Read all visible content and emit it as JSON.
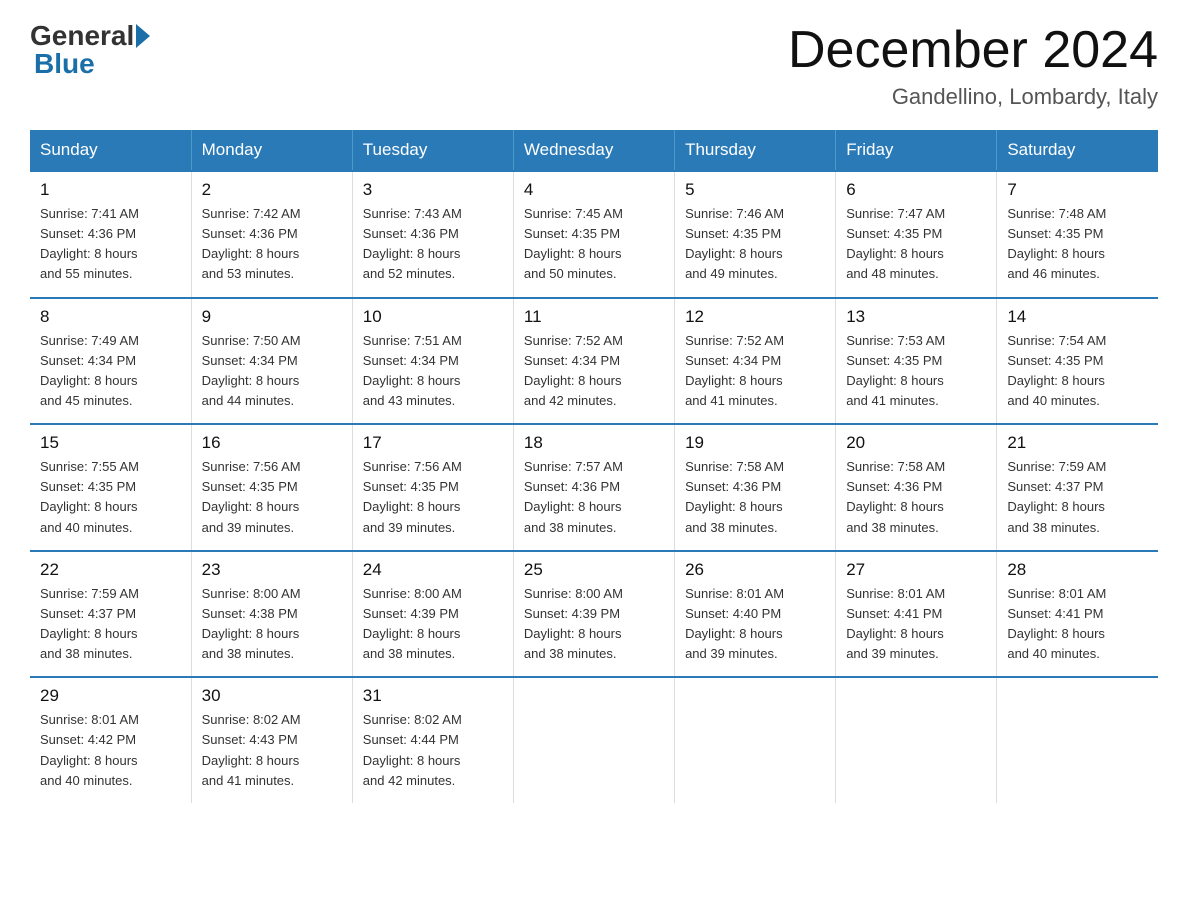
{
  "logo": {
    "general": "General",
    "blue": "Blue"
  },
  "title": "December 2024",
  "location": "Gandellino, Lombardy, Italy",
  "days_header": [
    "Sunday",
    "Monday",
    "Tuesday",
    "Wednesday",
    "Thursday",
    "Friday",
    "Saturday"
  ],
  "weeks": [
    [
      {
        "num": "1",
        "info": "Sunrise: 7:41 AM\nSunset: 4:36 PM\nDaylight: 8 hours\nand 55 minutes."
      },
      {
        "num": "2",
        "info": "Sunrise: 7:42 AM\nSunset: 4:36 PM\nDaylight: 8 hours\nand 53 minutes."
      },
      {
        "num": "3",
        "info": "Sunrise: 7:43 AM\nSunset: 4:36 PM\nDaylight: 8 hours\nand 52 minutes."
      },
      {
        "num": "4",
        "info": "Sunrise: 7:45 AM\nSunset: 4:35 PM\nDaylight: 8 hours\nand 50 minutes."
      },
      {
        "num": "5",
        "info": "Sunrise: 7:46 AM\nSunset: 4:35 PM\nDaylight: 8 hours\nand 49 minutes."
      },
      {
        "num": "6",
        "info": "Sunrise: 7:47 AM\nSunset: 4:35 PM\nDaylight: 8 hours\nand 48 minutes."
      },
      {
        "num": "7",
        "info": "Sunrise: 7:48 AM\nSunset: 4:35 PM\nDaylight: 8 hours\nand 46 minutes."
      }
    ],
    [
      {
        "num": "8",
        "info": "Sunrise: 7:49 AM\nSunset: 4:34 PM\nDaylight: 8 hours\nand 45 minutes."
      },
      {
        "num": "9",
        "info": "Sunrise: 7:50 AM\nSunset: 4:34 PM\nDaylight: 8 hours\nand 44 minutes."
      },
      {
        "num": "10",
        "info": "Sunrise: 7:51 AM\nSunset: 4:34 PM\nDaylight: 8 hours\nand 43 minutes."
      },
      {
        "num": "11",
        "info": "Sunrise: 7:52 AM\nSunset: 4:34 PM\nDaylight: 8 hours\nand 42 minutes."
      },
      {
        "num": "12",
        "info": "Sunrise: 7:52 AM\nSunset: 4:34 PM\nDaylight: 8 hours\nand 41 minutes."
      },
      {
        "num": "13",
        "info": "Sunrise: 7:53 AM\nSunset: 4:35 PM\nDaylight: 8 hours\nand 41 minutes."
      },
      {
        "num": "14",
        "info": "Sunrise: 7:54 AM\nSunset: 4:35 PM\nDaylight: 8 hours\nand 40 minutes."
      }
    ],
    [
      {
        "num": "15",
        "info": "Sunrise: 7:55 AM\nSunset: 4:35 PM\nDaylight: 8 hours\nand 40 minutes."
      },
      {
        "num": "16",
        "info": "Sunrise: 7:56 AM\nSunset: 4:35 PM\nDaylight: 8 hours\nand 39 minutes."
      },
      {
        "num": "17",
        "info": "Sunrise: 7:56 AM\nSunset: 4:35 PM\nDaylight: 8 hours\nand 39 minutes."
      },
      {
        "num": "18",
        "info": "Sunrise: 7:57 AM\nSunset: 4:36 PM\nDaylight: 8 hours\nand 38 minutes."
      },
      {
        "num": "19",
        "info": "Sunrise: 7:58 AM\nSunset: 4:36 PM\nDaylight: 8 hours\nand 38 minutes."
      },
      {
        "num": "20",
        "info": "Sunrise: 7:58 AM\nSunset: 4:36 PM\nDaylight: 8 hours\nand 38 minutes."
      },
      {
        "num": "21",
        "info": "Sunrise: 7:59 AM\nSunset: 4:37 PM\nDaylight: 8 hours\nand 38 minutes."
      }
    ],
    [
      {
        "num": "22",
        "info": "Sunrise: 7:59 AM\nSunset: 4:37 PM\nDaylight: 8 hours\nand 38 minutes."
      },
      {
        "num": "23",
        "info": "Sunrise: 8:00 AM\nSunset: 4:38 PM\nDaylight: 8 hours\nand 38 minutes."
      },
      {
        "num": "24",
        "info": "Sunrise: 8:00 AM\nSunset: 4:39 PM\nDaylight: 8 hours\nand 38 minutes."
      },
      {
        "num": "25",
        "info": "Sunrise: 8:00 AM\nSunset: 4:39 PM\nDaylight: 8 hours\nand 38 minutes."
      },
      {
        "num": "26",
        "info": "Sunrise: 8:01 AM\nSunset: 4:40 PM\nDaylight: 8 hours\nand 39 minutes."
      },
      {
        "num": "27",
        "info": "Sunrise: 8:01 AM\nSunset: 4:41 PM\nDaylight: 8 hours\nand 39 minutes."
      },
      {
        "num": "28",
        "info": "Sunrise: 8:01 AM\nSunset: 4:41 PM\nDaylight: 8 hours\nand 40 minutes."
      }
    ],
    [
      {
        "num": "29",
        "info": "Sunrise: 8:01 AM\nSunset: 4:42 PM\nDaylight: 8 hours\nand 40 minutes."
      },
      {
        "num": "30",
        "info": "Sunrise: 8:02 AM\nSunset: 4:43 PM\nDaylight: 8 hours\nand 41 minutes."
      },
      {
        "num": "31",
        "info": "Sunrise: 8:02 AM\nSunset: 4:44 PM\nDaylight: 8 hours\nand 42 minutes."
      },
      {
        "num": "",
        "info": ""
      },
      {
        "num": "",
        "info": ""
      },
      {
        "num": "",
        "info": ""
      },
      {
        "num": "",
        "info": ""
      }
    ]
  ]
}
